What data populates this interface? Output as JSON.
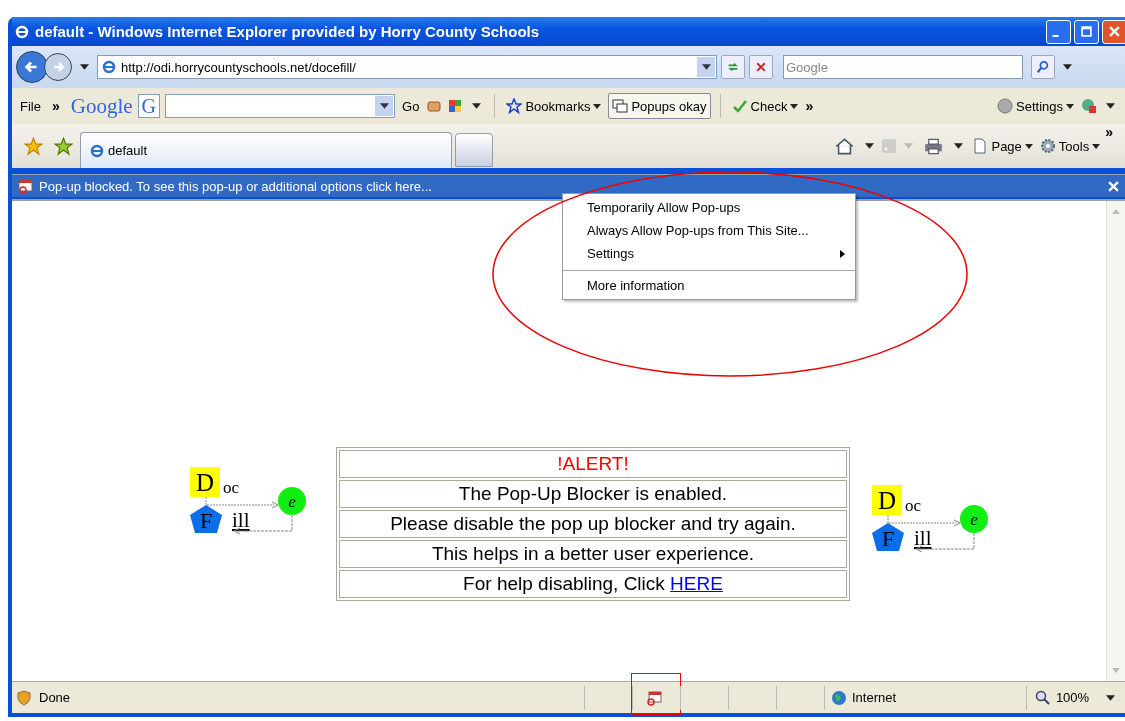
{
  "window": {
    "title": "default - Windows Internet Explorer provided by Horry County Schools"
  },
  "address_bar": {
    "url": "http://odi.horrycountyschools.net/docefill/",
    "search_placeholder": "Google"
  },
  "toolbar": {
    "menu": "File",
    "more_left": "»",
    "google_logo": "Google",
    "google_g": "G",
    "go": "Go",
    "bookmarks": "Bookmarks",
    "popups": "Popups okay",
    "check": "Check",
    "more_right": "»",
    "settings": "Settings"
  },
  "tabs": [
    {
      "label": "default",
      "selected": true
    }
  ],
  "command_bar": {
    "page": "Page",
    "tools": "Tools",
    "more": "»"
  },
  "info_bar": {
    "text": "Pop-up blocked. To see this pop-up or additional options click here..."
  },
  "context_menu": [
    {
      "label": "Temporarily Allow Pop-ups",
      "submenu": false,
      "separator_before": false
    },
    {
      "label": "Always Allow Pop-ups from This Site...",
      "submenu": false,
      "separator_before": false
    },
    {
      "label": "Settings",
      "submenu": true,
      "separator_before": false
    },
    {
      "label": "More information",
      "submenu": false,
      "separator_before": true
    }
  ],
  "logos": [
    {
      "d": "D",
      "oc": "oc",
      "e": "e",
      "f": "F",
      "ill": "ill"
    },
    {
      "d": "D",
      "oc": "oc",
      "e": "e",
      "f": "F",
      "ill": "ill"
    }
  ],
  "alert_rows": [
    {
      "kind": "heading",
      "text": "!ALERT!"
    },
    {
      "kind": "text",
      "text": "The Pop-Up Blocker is enabled."
    },
    {
      "kind": "text",
      "text": "Please disable the pop up blocker and try again."
    },
    {
      "kind": "text",
      "text": "This helps in a better user experience."
    },
    {
      "kind": "link",
      "text": "For help disabling, Click ",
      "link": "HERE"
    }
  ],
  "status_bar": {
    "status": "Done",
    "zone": "Internet",
    "zoom": "100%"
  }
}
